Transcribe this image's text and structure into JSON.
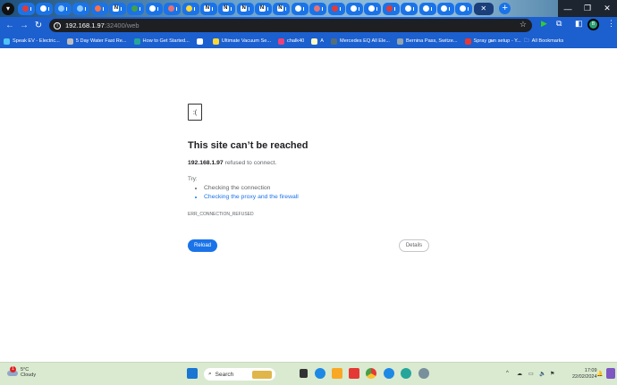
{
  "browser": {
    "tabs": [
      {
        "icon": "youtube-icon",
        "color": "#e53935"
      },
      {
        "icon": "generic-icon",
        "color": "#ffffff"
      },
      {
        "icon": "arrow-icon",
        "color": "#90caf9"
      },
      {
        "icon": "arrow-icon",
        "color": "#90caf9"
      },
      {
        "icon": "orange-app-icon",
        "color": "#ff7043"
      },
      {
        "icon": "notion-icon",
        "color": "#ffffff"
      },
      {
        "icon": "rainbow-icon",
        "color": "#43a047"
      },
      {
        "icon": "a-icon",
        "color": "#ffffff"
      },
      {
        "icon": "red-circle-icon",
        "color": "#e57373"
      },
      {
        "icon": "colorful-icon",
        "color": "#fdd835"
      },
      {
        "icon": "notion-icon",
        "color": "#ffffff"
      },
      {
        "icon": "notion-icon",
        "color": "#ffffff"
      },
      {
        "icon": "notion-icon",
        "color": "#ffffff"
      },
      {
        "icon": "notion-icon",
        "color": "#ffffff"
      },
      {
        "icon": "notion-icon",
        "color": "#ffffff"
      },
      {
        "icon": "generic-icon",
        "color": "#ffffff"
      },
      {
        "icon": "red-circle-icon",
        "color": "#e57373"
      },
      {
        "icon": "youtube-icon",
        "color": "#e53935"
      },
      {
        "icon": "generic-icon",
        "color": "#ffffff"
      },
      {
        "icon": "generic-icon",
        "color": "#ffffff"
      },
      {
        "icon": "youtube-icon",
        "color": "#e53935"
      },
      {
        "icon": "generic-icon",
        "color": "#ffffff"
      },
      {
        "icon": "generic-icon",
        "color": "#ffffff"
      },
      {
        "icon": "square-icon",
        "color": "#ffffff"
      },
      {
        "icon": "square-icon",
        "color": "#ffffff"
      }
    ],
    "notion_letter": "N",
    "active_tab_close": "✕",
    "new_tab": "+",
    "url_host": "192.168.1.97",
    "url_rest": ":32400/web",
    "bookmarks": [
      {
        "label": "Speak EV - Electric...",
        "color": "#4fc3f7"
      },
      {
        "label": "5 Day Water Fast Re...",
        "color": "#bdbdbd"
      },
      {
        "label": "How to Get Started...",
        "color": "#26a69a"
      },
      {
        "label": "",
        "color": "#ffffff"
      },
      {
        "label": "Ultimate Vacuum Se...",
        "color": "#fdd835"
      },
      {
        "label": "chalk40",
        "color": "#ec407a"
      },
      {
        "label": "A",
        "color": "#fff9c4"
      },
      {
        "label": "Mercedes EQ All Ele...",
        "color": "#546e7a"
      },
      {
        "label": "Bernina Pass, Switze...",
        "color": "#90a4ae"
      },
      {
        "label": "Spray gun setup - Y...",
        "color": "#e53935"
      }
    ],
    "more_bookmarks": "»",
    "all_bookmarks": "All Bookmarks",
    "profile_initial": "B"
  },
  "error_page": {
    "title": "This site can’t be reached",
    "host": "192.168.1.97",
    "message": " refused to connect.",
    "try_label": "Try:",
    "suggestions": [
      "Checking the connection",
      "Checking the proxy and the firewall"
    ],
    "error_code": "ERR_CONNECTION_REFUSED",
    "reload_label": "Reload",
    "details_label": "Details"
  },
  "taskbar": {
    "weather_temp": "5°C",
    "weather_desc": "Cloudy",
    "weather_badge": "1",
    "search_placeholder": "Search",
    "time": "17:09",
    "date": "22/02/2024",
    "tray_chevron": "^"
  }
}
